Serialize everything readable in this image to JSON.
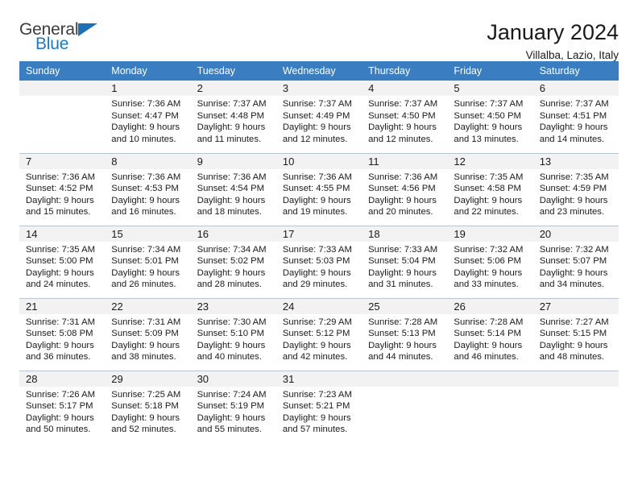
{
  "brand": {
    "name_top": "General",
    "name_bottom": "Blue",
    "flag_icon": "blue-triangle-flag",
    "accent_color": "#1f7ac4"
  },
  "header": {
    "month_title": "January 2024",
    "location": "Villalba, Lazio, Italy"
  },
  "calendar": {
    "header_bg": "#3a7dc0",
    "daynum_bg": "#f2f2f2",
    "weekdays": [
      "Sunday",
      "Monday",
      "Tuesday",
      "Wednesday",
      "Thursday",
      "Friday",
      "Saturday"
    ],
    "weeks": [
      [
        {
          "day": "",
          "empty": true,
          "sunrise": "",
          "sunset": "",
          "daylight_line1": "",
          "daylight_line2": ""
        },
        {
          "day": "1",
          "empty": false,
          "sunrise": "Sunrise: 7:36 AM",
          "sunset": "Sunset: 4:47 PM",
          "daylight_line1": "Daylight: 9 hours",
          "daylight_line2": "and 10 minutes."
        },
        {
          "day": "2",
          "empty": false,
          "sunrise": "Sunrise: 7:37 AM",
          "sunset": "Sunset: 4:48 PM",
          "daylight_line1": "Daylight: 9 hours",
          "daylight_line2": "and 11 minutes."
        },
        {
          "day": "3",
          "empty": false,
          "sunrise": "Sunrise: 7:37 AM",
          "sunset": "Sunset: 4:49 PM",
          "daylight_line1": "Daylight: 9 hours",
          "daylight_line2": "and 12 minutes."
        },
        {
          "day": "4",
          "empty": false,
          "sunrise": "Sunrise: 7:37 AM",
          "sunset": "Sunset: 4:50 PM",
          "daylight_line1": "Daylight: 9 hours",
          "daylight_line2": "and 12 minutes."
        },
        {
          "day": "5",
          "empty": false,
          "sunrise": "Sunrise: 7:37 AM",
          "sunset": "Sunset: 4:50 PM",
          "daylight_line1": "Daylight: 9 hours",
          "daylight_line2": "and 13 minutes."
        },
        {
          "day": "6",
          "empty": false,
          "sunrise": "Sunrise: 7:37 AM",
          "sunset": "Sunset: 4:51 PM",
          "daylight_line1": "Daylight: 9 hours",
          "daylight_line2": "and 14 minutes."
        }
      ],
      [
        {
          "day": "7",
          "empty": false,
          "sunrise": "Sunrise: 7:36 AM",
          "sunset": "Sunset: 4:52 PM",
          "daylight_line1": "Daylight: 9 hours",
          "daylight_line2": "and 15 minutes."
        },
        {
          "day": "8",
          "empty": false,
          "sunrise": "Sunrise: 7:36 AM",
          "sunset": "Sunset: 4:53 PM",
          "daylight_line1": "Daylight: 9 hours",
          "daylight_line2": "and 16 minutes."
        },
        {
          "day": "9",
          "empty": false,
          "sunrise": "Sunrise: 7:36 AM",
          "sunset": "Sunset: 4:54 PM",
          "daylight_line1": "Daylight: 9 hours",
          "daylight_line2": "and 18 minutes."
        },
        {
          "day": "10",
          "empty": false,
          "sunrise": "Sunrise: 7:36 AM",
          "sunset": "Sunset: 4:55 PM",
          "daylight_line1": "Daylight: 9 hours",
          "daylight_line2": "and 19 minutes."
        },
        {
          "day": "11",
          "empty": false,
          "sunrise": "Sunrise: 7:36 AM",
          "sunset": "Sunset: 4:56 PM",
          "daylight_line1": "Daylight: 9 hours",
          "daylight_line2": "and 20 minutes."
        },
        {
          "day": "12",
          "empty": false,
          "sunrise": "Sunrise: 7:35 AM",
          "sunset": "Sunset: 4:58 PM",
          "daylight_line1": "Daylight: 9 hours",
          "daylight_line2": "and 22 minutes."
        },
        {
          "day": "13",
          "empty": false,
          "sunrise": "Sunrise: 7:35 AM",
          "sunset": "Sunset: 4:59 PM",
          "daylight_line1": "Daylight: 9 hours",
          "daylight_line2": "and 23 minutes."
        }
      ],
      [
        {
          "day": "14",
          "empty": false,
          "sunrise": "Sunrise: 7:35 AM",
          "sunset": "Sunset: 5:00 PM",
          "daylight_line1": "Daylight: 9 hours",
          "daylight_line2": "and 24 minutes."
        },
        {
          "day": "15",
          "empty": false,
          "sunrise": "Sunrise: 7:34 AM",
          "sunset": "Sunset: 5:01 PM",
          "daylight_line1": "Daylight: 9 hours",
          "daylight_line2": "and 26 minutes."
        },
        {
          "day": "16",
          "empty": false,
          "sunrise": "Sunrise: 7:34 AM",
          "sunset": "Sunset: 5:02 PM",
          "daylight_line1": "Daylight: 9 hours",
          "daylight_line2": "and 28 minutes."
        },
        {
          "day": "17",
          "empty": false,
          "sunrise": "Sunrise: 7:33 AM",
          "sunset": "Sunset: 5:03 PM",
          "daylight_line1": "Daylight: 9 hours",
          "daylight_line2": "and 29 minutes."
        },
        {
          "day": "18",
          "empty": false,
          "sunrise": "Sunrise: 7:33 AM",
          "sunset": "Sunset: 5:04 PM",
          "daylight_line1": "Daylight: 9 hours",
          "daylight_line2": "and 31 minutes."
        },
        {
          "day": "19",
          "empty": false,
          "sunrise": "Sunrise: 7:32 AM",
          "sunset": "Sunset: 5:06 PM",
          "daylight_line1": "Daylight: 9 hours",
          "daylight_line2": "and 33 minutes."
        },
        {
          "day": "20",
          "empty": false,
          "sunrise": "Sunrise: 7:32 AM",
          "sunset": "Sunset: 5:07 PM",
          "daylight_line1": "Daylight: 9 hours",
          "daylight_line2": "and 34 minutes."
        }
      ],
      [
        {
          "day": "21",
          "empty": false,
          "sunrise": "Sunrise: 7:31 AM",
          "sunset": "Sunset: 5:08 PM",
          "daylight_line1": "Daylight: 9 hours",
          "daylight_line2": "and 36 minutes."
        },
        {
          "day": "22",
          "empty": false,
          "sunrise": "Sunrise: 7:31 AM",
          "sunset": "Sunset: 5:09 PM",
          "daylight_line1": "Daylight: 9 hours",
          "daylight_line2": "and 38 minutes."
        },
        {
          "day": "23",
          "empty": false,
          "sunrise": "Sunrise: 7:30 AM",
          "sunset": "Sunset: 5:10 PM",
          "daylight_line1": "Daylight: 9 hours",
          "daylight_line2": "and 40 minutes."
        },
        {
          "day": "24",
          "empty": false,
          "sunrise": "Sunrise: 7:29 AM",
          "sunset": "Sunset: 5:12 PM",
          "daylight_line1": "Daylight: 9 hours",
          "daylight_line2": "and 42 minutes."
        },
        {
          "day": "25",
          "empty": false,
          "sunrise": "Sunrise: 7:28 AM",
          "sunset": "Sunset: 5:13 PM",
          "daylight_line1": "Daylight: 9 hours",
          "daylight_line2": "and 44 minutes."
        },
        {
          "day": "26",
          "empty": false,
          "sunrise": "Sunrise: 7:28 AM",
          "sunset": "Sunset: 5:14 PM",
          "daylight_line1": "Daylight: 9 hours",
          "daylight_line2": "and 46 minutes."
        },
        {
          "day": "27",
          "empty": false,
          "sunrise": "Sunrise: 7:27 AM",
          "sunset": "Sunset: 5:15 PM",
          "daylight_line1": "Daylight: 9 hours",
          "daylight_line2": "and 48 minutes."
        }
      ],
      [
        {
          "day": "28",
          "empty": false,
          "sunrise": "Sunrise: 7:26 AM",
          "sunset": "Sunset: 5:17 PM",
          "daylight_line1": "Daylight: 9 hours",
          "daylight_line2": "and 50 minutes."
        },
        {
          "day": "29",
          "empty": false,
          "sunrise": "Sunrise: 7:25 AM",
          "sunset": "Sunset: 5:18 PM",
          "daylight_line1": "Daylight: 9 hours",
          "daylight_line2": "and 52 minutes."
        },
        {
          "day": "30",
          "empty": false,
          "sunrise": "Sunrise: 7:24 AM",
          "sunset": "Sunset: 5:19 PM",
          "daylight_line1": "Daylight: 9 hours",
          "daylight_line2": "and 55 minutes."
        },
        {
          "day": "31",
          "empty": false,
          "sunrise": "Sunrise: 7:23 AM",
          "sunset": "Sunset: 5:21 PM",
          "daylight_line1": "Daylight: 9 hours",
          "daylight_line2": "and 57 minutes."
        },
        {
          "day": "",
          "empty": true,
          "sunrise": "",
          "sunset": "",
          "daylight_line1": "",
          "daylight_line2": ""
        },
        {
          "day": "",
          "empty": true,
          "sunrise": "",
          "sunset": "",
          "daylight_line1": "",
          "daylight_line2": ""
        },
        {
          "day": "",
          "empty": true,
          "sunrise": "",
          "sunset": "",
          "daylight_line1": "",
          "daylight_line2": ""
        }
      ]
    ]
  }
}
